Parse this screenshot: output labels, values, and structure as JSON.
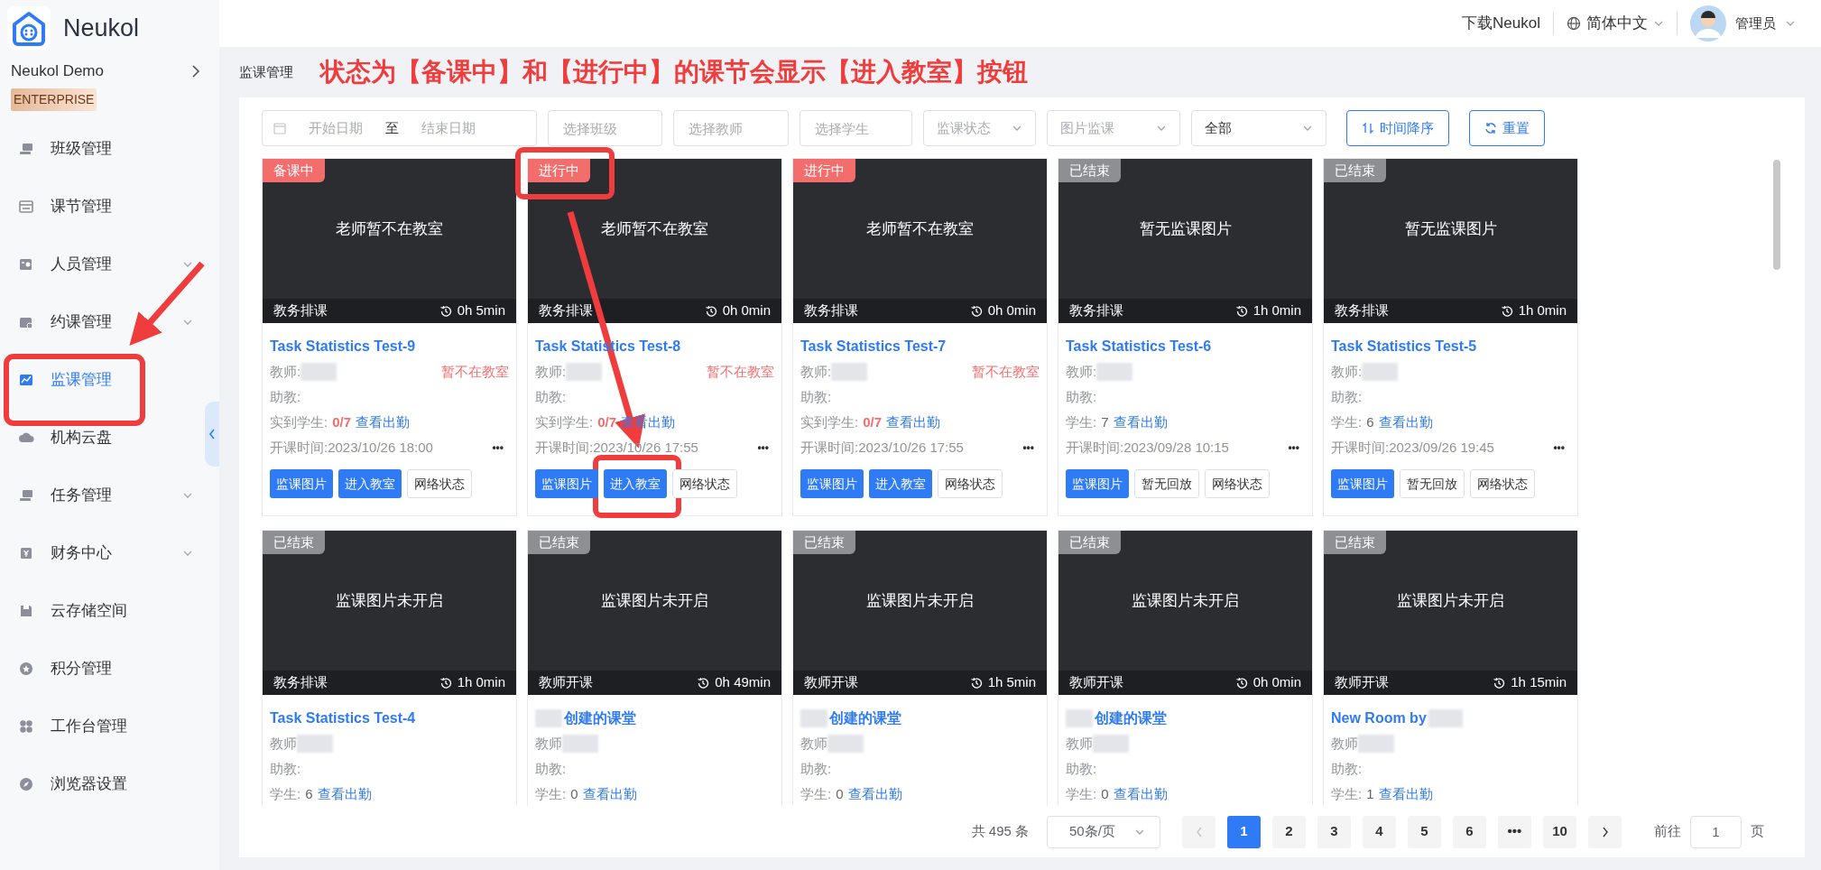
{
  "logo": {
    "text": "Neukol"
  },
  "org": {
    "name": "Neukol Demo",
    "badge": "ENTERPRISE"
  },
  "sidebar": {
    "items": [
      {
        "label": "班级管理",
        "selected": false,
        "expandable": false
      },
      {
        "label": "课节管理",
        "selected": false,
        "expandable": false
      },
      {
        "label": "人员管理",
        "selected": false,
        "expandable": true
      },
      {
        "label": "约课管理",
        "selected": false,
        "expandable": true
      },
      {
        "label": "监课管理",
        "selected": true,
        "expandable": false
      },
      {
        "label": "机构云盘",
        "selected": false,
        "expandable": false
      },
      {
        "label": "任务管理",
        "selected": false,
        "expandable": true
      },
      {
        "label": "财务中心",
        "selected": false,
        "expandable": true
      },
      {
        "label": "云存储空间",
        "selected": false,
        "expandable": false
      },
      {
        "label": "积分管理",
        "selected": false,
        "expandable": false
      },
      {
        "label": "工作台管理",
        "selected": false,
        "expandable": false
      },
      {
        "label": "浏览器设置",
        "selected": false,
        "expandable": false
      }
    ]
  },
  "header": {
    "download": "下载Neukol",
    "language": "简体中文",
    "user": "管理员"
  },
  "breadcrumb": "监课管理",
  "annotation": "状态为【备课中】和【进行中】的课节会显示【进入教室】按钮",
  "filters": {
    "start_placeholder": "开始日期",
    "range_separator": "至",
    "end_placeholder": "结束日期",
    "inputs": [
      {
        "placeholder": "选择班级"
      },
      {
        "placeholder": "选择教师"
      },
      {
        "placeholder": "选择学生"
      }
    ],
    "selects": [
      {
        "kind": "placeholder",
        "text": "监课状态"
      },
      {
        "kind": "placeholder",
        "text": "图片监课"
      },
      {
        "kind": "value",
        "text": "全部"
      }
    ],
    "buttons": [
      {
        "label": "时间降序",
        "kind": "sort"
      },
      {
        "label": "重置",
        "kind": "reset"
      }
    ]
  },
  "cards": [
    {
      "tag": {
        "label": "备课中",
        "kind": "active"
      },
      "preview": "老师暂不在教室",
      "source": "教务排课",
      "duration": "0h 5min",
      "title": "Task Statistics Test-9",
      "teacher": "教师:",
      "teacher_status": "暂不在教室",
      "assistant": "助教:",
      "students_label": "实到学生:",
      "students": "0/7",
      "students_alert": true,
      "attendance": "查看出勤",
      "start": "开课时间:2023/10/26 18:00",
      "more": "•••",
      "buttons": [
        {
          "label": "监课图片",
          "kind": "primary"
        },
        {
          "label": "进入教室",
          "kind": "primary"
        },
        {
          "label": "网络状态",
          "kind": "default"
        }
      ]
    },
    {
      "tag": {
        "label": "进行中",
        "kind": "active"
      },
      "preview": "老师暂不在教室",
      "source": "教务排课",
      "duration": "0h 0min",
      "title": "Task Statistics Test-8",
      "teacher": "教师:",
      "teacher_status": "暂不在教室",
      "assistant": "助教:",
      "students_label": "实到学生:",
      "students": "0/7",
      "students_alert": true,
      "attendance": "查看出勤",
      "start": "开课时间:2023/10/26 17:55",
      "more": "•••",
      "buttons": [
        {
          "label": "监课图片",
          "kind": "primary"
        },
        {
          "label": "进入教室",
          "kind": "primary"
        },
        {
          "label": "网络状态",
          "kind": "default"
        }
      ]
    },
    {
      "tag": {
        "label": "进行中",
        "kind": "active"
      },
      "preview": "老师暂不在教室",
      "source": "教务排课",
      "duration": "0h 0min",
      "title": "Task Statistics Test-7",
      "teacher": "教师:",
      "teacher_status": "暂不在教室",
      "assistant": "助教:",
      "students_label": "实到学生:",
      "students": "0/7",
      "students_alert": true,
      "attendance": "查看出勤",
      "start": "开课时间:2023/10/26 17:55",
      "more": "•••",
      "buttons": [
        {
          "label": "监课图片",
          "kind": "primary"
        },
        {
          "label": "进入教室",
          "kind": "primary"
        },
        {
          "label": "网络状态",
          "kind": "default"
        }
      ]
    },
    {
      "tag": {
        "label": "已结束",
        "kind": "ended"
      },
      "preview": "暂无监课图片",
      "source": "教务排课",
      "duration": "1h 0min",
      "title": "Task Statistics Test-6",
      "teacher": "教师:",
      "assistant": "助教:",
      "students_label": "学生:",
      "students": "7",
      "students_alert": false,
      "attendance": "查看出勤",
      "start": "开课时间:2023/09/28 10:15",
      "more": "•••",
      "buttons": [
        {
          "label": "监课图片",
          "kind": "primary"
        },
        {
          "label": "暂无回放",
          "kind": "default"
        },
        {
          "label": "网络状态",
          "kind": "default"
        }
      ]
    },
    {
      "tag": {
        "label": "已结束",
        "kind": "ended"
      },
      "preview": "暂无监课图片",
      "source": "教务排课",
      "duration": "1h 0min",
      "title": "Task Statistics Test-5",
      "teacher": "教师:",
      "assistant": "助教:",
      "students_label": "学生:",
      "students": "6",
      "students_alert": false,
      "attendance": "查看出勤",
      "start": "开课时间:2023/09/26 19:45",
      "more": "•••",
      "buttons": [
        {
          "label": "监课图片",
          "kind": "primary"
        },
        {
          "label": "暂无回放",
          "kind": "default"
        },
        {
          "label": "网络状态",
          "kind": "default"
        }
      ]
    },
    {
      "tag": {
        "label": "已结束",
        "kind": "ended"
      },
      "preview": "监课图片未开启",
      "source": "教务排课",
      "duration": "1h 0min",
      "title": "Task Statistics Test-4",
      "teacher": "教师",
      "assistant": "助教:",
      "students_label": "学生:",
      "students": "6",
      "students_alert": false,
      "attendance": "查看出勤"
    },
    {
      "tag": {
        "label": "已结束",
        "kind": "ended"
      },
      "preview": "监课图片未开启",
      "source": "教师开课",
      "duration": "0h 49min",
      "title": "创建的课堂",
      "redacted_before": true,
      "teacher": "教师",
      "assistant": "助教:",
      "students_label": "学生:",
      "students": "0",
      "students_alert": false,
      "attendance": "查看出勤"
    },
    {
      "tag": {
        "label": "已结束",
        "kind": "ended"
      },
      "preview": "监课图片未开启",
      "source": "教师开课",
      "duration": "1h 5min",
      "title": "创建的课堂",
      "redacted_before": true,
      "teacher": "教师",
      "assistant": "助教:",
      "students_label": "学生:",
      "students": "0",
      "students_alert": false,
      "attendance": "查看出勤"
    },
    {
      "tag": {
        "label": "已结束",
        "kind": "ended"
      },
      "preview": "监课图片未开启",
      "source": "教师开课",
      "duration": "0h 0min",
      "title": "创建的课堂",
      "redacted_before": true,
      "teacher": "教师",
      "assistant": "助教:",
      "students_label": "学生:",
      "students": "0",
      "students_alert": false,
      "attendance": "查看出勤"
    },
    {
      "tag": {
        "label": "已结束",
        "kind": "ended"
      },
      "preview": "监课图片未开启",
      "source": "教师开课",
      "duration": "1h 15min",
      "title": "New Room by",
      "redacted_after": true,
      "teacher": "教师",
      "assistant": "助教:",
      "students_label": "学生:",
      "students": "1",
      "students_alert": false,
      "attendance": "查看出勤"
    }
  ],
  "pagination": {
    "total": "共 495 条",
    "page_size": "50条/页",
    "prev_disabled": true,
    "pages": [
      {
        "label": "1",
        "selected": true
      },
      {
        "label": "2",
        "selected": false
      },
      {
        "label": "3",
        "selected": false
      },
      {
        "label": "4",
        "selected": false
      },
      {
        "label": "5",
        "selected": false
      },
      {
        "label": "6",
        "selected": false
      },
      {
        "label": "•••",
        "selected": false
      },
      {
        "label": "10",
        "selected": false
      }
    ],
    "goto_label": "前往",
    "goto_value": "1",
    "goto_suffix": "页"
  }
}
